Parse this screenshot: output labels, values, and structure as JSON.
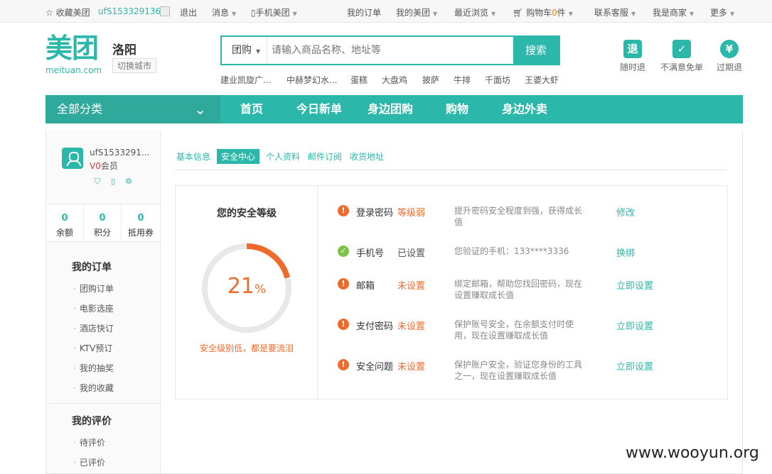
{
  "topbar": {
    "favorite": "☆ 收藏美团",
    "user_id": "ufS153329136",
    "logout": "退出",
    "messages": "消息",
    "mobile_meituan": "手机美团",
    "my_orders": "我的订单",
    "my_meituan": "我的美团",
    "recent": "最近浏览",
    "cart_prefix": "购物车",
    "cart_count": "0",
    "cart_suffix": "件",
    "service": "联系客服",
    "merchant": "我是商家",
    "more": "更多"
  },
  "header": {
    "logo_mark": "美团",
    "logo_url": "meituan.com",
    "city": "洛阳",
    "switch_city": "切换城市",
    "search_category": "团购",
    "search_placeholder": "请输入商品名称、地址等",
    "search_button": "搜索",
    "hot_keywords": [
      "建业凯旋广...",
      "中赫梦幻水...",
      "蛋糕",
      "大盘鸡",
      "披萨",
      "牛排",
      "千面坊",
      "王婆大虾"
    ],
    "promises": [
      {
        "label": "随时退",
        "icon": "退"
      },
      {
        "label": "不满意免单",
        "icon": "✓"
      },
      {
        "label": "过期退",
        "icon": "¥"
      }
    ]
  },
  "nav": {
    "all_categories": "全部分类",
    "links": [
      "首页",
      "今日新单",
      "身边团购",
      "购物",
      "身边外卖"
    ]
  },
  "sidebar": {
    "username": "ufS1533291...",
    "level_prefix": "V0",
    "level_suffix": "会员",
    "stats": [
      {
        "value": "0",
        "label": "余额"
      },
      {
        "value": "0",
        "label": "积分"
      },
      {
        "value": "0",
        "label": "抵用券"
      }
    ],
    "orders_title": "我的订单",
    "order_items": [
      "团购订单",
      "电影选座",
      "酒店快订",
      "KTV预订",
      "我的抽奖",
      "我的收藏"
    ],
    "reviews_title": "我的评价",
    "review_items": [
      "待评价",
      "已评价"
    ]
  },
  "main": {
    "tabs": [
      {
        "label": "基本信息",
        "active": false
      },
      {
        "label": "安全中心",
        "active": true
      },
      {
        "label": "个人资料",
        "active": false
      },
      {
        "label": "邮件订阅",
        "active": false
      },
      {
        "label": "收货地址",
        "active": false
      }
    ],
    "level_title": "您的安全等级",
    "level_percent": 21,
    "level_percent_text": "21",
    "percent_symbol": "%",
    "level_warning": "安全级别低，都是要流泪",
    "items": [
      {
        "name": "登录密码",
        "state": "等级弱",
        "ok": false,
        "desc": "提升密码安全程度到强，获得成长值",
        "action": "修改"
      },
      {
        "name": "手机号",
        "state": "已设置",
        "ok": true,
        "desc": "您验证的手机：133****3336",
        "action": "换绑"
      },
      {
        "name": "邮箱",
        "state": "未设置",
        "ok": false,
        "desc": "绑定邮箱，帮助您找回密码，现在设置赚取成长值",
        "action": "立即设置"
      },
      {
        "name": "支付密码",
        "state": "未设置",
        "ok": false,
        "desc": "保护账号安全，在余额支付时使用，现在设置赚取成长值",
        "action": "立即设置"
      },
      {
        "name": "安全问题",
        "state": "未设置",
        "ok": false,
        "desc": "保护账户安全，验证您身份的工具之一，现在设置赚取成长值",
        "action": "立即设置"
      }
    ]
  },
  "watermark": "www.wooyun.org",
  "colors": {
    "brand": "#2bb8aa",
    "warning": "#f06b2b",
    "ok": "#7bc342"
  }
}
